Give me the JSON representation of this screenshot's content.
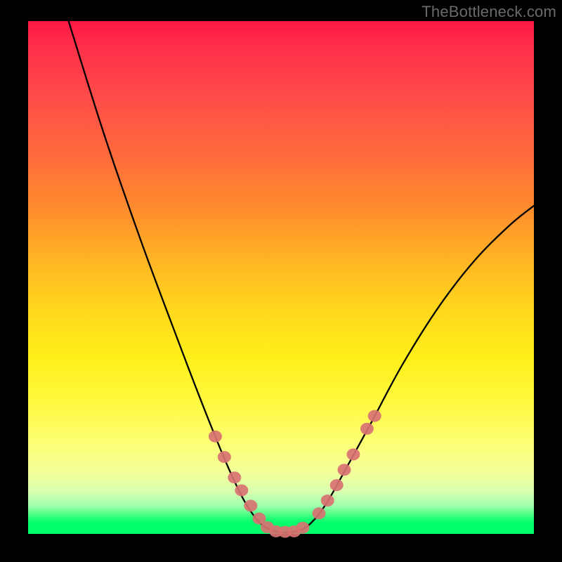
{
  "watermark": "TheBottleneck.com",
  "chart_data": {
    "type": "line",
    "title": "",
    "xlabel": "",
    "ylabel": "",
    "xlim": [
      0,
      100
    ],
    "ylim": [
      0,
      100
    ],
    "curve": {
      "name": "bottleneck-curve",
      "points": [
        {
          "x": 8.0,
          "y": 100.0
        },
        {
          "x": 15.0,
          "y": 78.0
        },
        {
          "x": 22.0,
          "y": 58.0
        },
        {
          "x": 28.0,
          "y": 42.0
        },
        {
          "x": 33.0,
          "y": 29.0
        },
        {
          "x": 37.0,
          "y": 19.0
        },
        {
          "x": 40.0,
          "y": 12.0
        },
        {
          "x": 43.0,
          "y": 6.0
        },
        {
          "x": 46.0,
          "y": 2.0
        },
        {
          "x": 49.0,
          "y": 0.5
        },
        {
          "x": 53.0,
          "y": 0.5
        },
        {
          "x": 55.8,
          "y": 2.0
        },
        {
          "x": 59.0,
          "y": 6.0
        },
        {
          "x": 63.0,
          "y": 13.0
        },
        {
          "x": 68.0,
          "y": 22.0
        },
        {
          "x": 74.0,
          "y": 33.0
        },
        {
          "x": 81.0,
          "y": 44.0
        },
        {
          "x": 88.0,
          "y": 53.0
        },
        {
          "x": 95.0,
          "y": 60.0
        },
        {
          "x": 100.0,
          "y": 64.0
        }
      ]
    },
    "markers": {
      "name": "highlight-dots",
      "color": "#d87272",
      "points": [
        {
          "x": 37.0,
          "y": 19.0
        },
        {
          "x": 38.8,
          "y": 15.0
        },
        {
          "x": 40.8,
          "y": 11.0
        },
        {
          "x": 42.2,
          "y": 8.5
        },
        {
          "x": 44.0,
          "y": 5.5
        },
        {
          "x": 45.7,
          "y": 3.0
        },
        {
          "x": 47.3,
          "y": 1.3
        },
        {
          "x": 49.0,
          "y": 0.5
        },
        {
          "x": 50.8,
          "y": 0.4
        },
        {
          "x": 52.6,
          "y": 0.5
        },
        {
          "x": 54.3,
          "y": 1.2
        },
        {
          "x": 57.5,
          "y": 4.0
        },
        {
          "x": 59.2,
          "y": 6.5
        },
        {
          "x": 61.0,
          "y": 9.5
        },
        {
          "x": 62.5,
          "y": 12.5
        },
        {
          "x": 64.3,
          "y": 15.5
        },
        {
          "x": 67.0,
          "y": 20.5
        },
        {
          "x": 68.5,
          "y": 23.0
        }
      ]
    },
    "gradient_stops": [
      {
        "pos": 0.0,
        "color": "#ff1744"
      },
      {
        "pos": 0.35,
        "color": "#ff8a2e"
      },
      {
        "pos": 0.65,
        "color": "#fff01a"
      },
      {
        "pos": 0.92,
        "color": "#d6ffb0"
      },
      {
        "pos": 1.0,
        "color": "#00ff6a"
      }
    ]
  }
}
